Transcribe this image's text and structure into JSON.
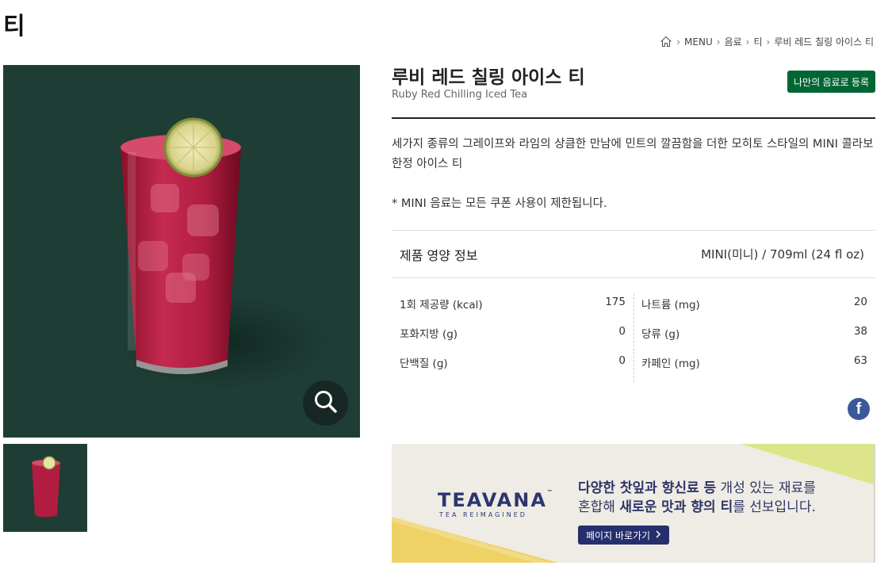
{
  "page": {
    "title": "티"
  },
  "breadcrumb": {
    "items": [
      "MENU",
      "음료",
      "티",
      "루비 레드 칠링 아이스 티"
    ]
  },
  "product": {
    "name_ko": "루비 레드 칠링 아이스 티",
    "name_en": "Ruby Red Chilling Iced Tea",
    "register_label": "나만의 음료로 등록",
    "description": "세가지 종류의 그레이프와 라임의 상큼한 만남에 민트의 깔끔함을 더한 모히토 스타일의 MINI 콜라보 한정 아이스 티",
    "notice": "* MINI 음료는 모든 쿠폰 사용이 제한됩니다."
  },
  "nutrition": {
    "title": "제품 영양 정보",
    "size": "MINI(미니) / 709ml (24 fl oz)",
    "left": [
      {
        "label": "1회 제공량 (kcal)",
        "value": "175"
      },
      {
        "label": "포화지방 (g)",
        "value": "0"
      },
      {
        "label": "단백질 (g)",
        "value": "0"
      }
    ],
    "right": [
      {
        "label": "나트륨 (mg)",
        "value": "20"
      },
      {
        "label": "당류 (g)",
        "value": "38"
      },
      {
        "label": "카페인 (mg)",
        "value": "63"
      }
    ]
  },
  "banner": {
    "logo_text": "TEAVANA",
    "logo_tm": "™",
    "logo_sub": "TEA REIMAGINED",
    "line1_bold": "다양한 찻잎과 향신료 등",
    "line1_rest": " 개성 있는 재료를",
    "line2_a": "혼합해 ",
    "line2_bold": "새로운 맛과 향의 티",
    "line2_rest": "를 선보입니다.",
    "button_label": "페이지 바로가기"
  },
  "colors": {
    "brand_green": "#006633",
    "photo_bg": "#1e3d35",
    "banner_navy": "#262f6e",
    "facebook": "#3b5998"
  },
  "icons": [
    "home-icon",
    "search-icon",
    "facebook-icon",
    "chevron-right-icon"
  ]
}
